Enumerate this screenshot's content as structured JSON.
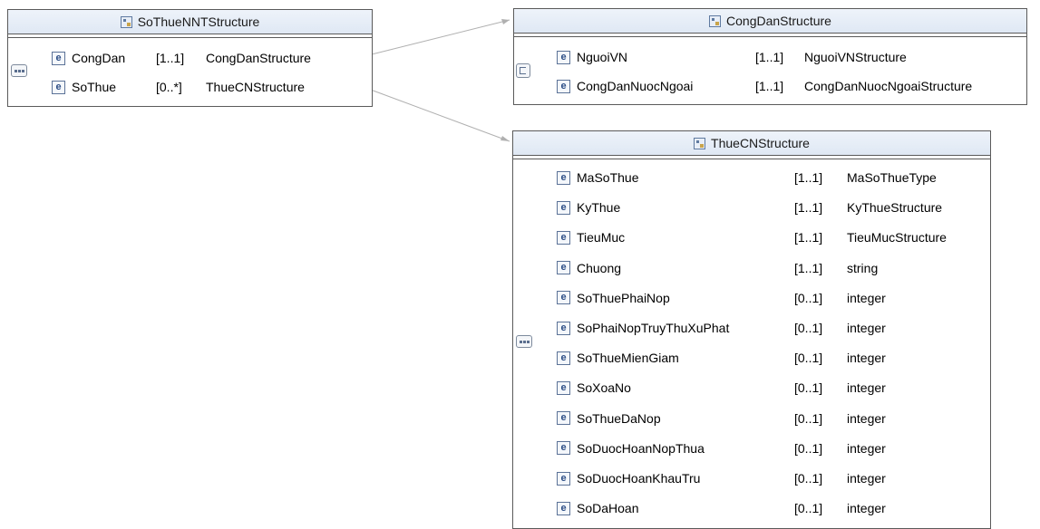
{
  "boxes": {
    "sothue": {
      "title": "SoThueNNTStructure",
      "rows": [
        {
          "name": "CongDan",
          "card": "[1..1]",
          "type": "CongDanStructure"
        },
        {
          "name": "SoThue",
          "card": "[0..*]",
          "type": "ThueCNStructure"
        }
      ]
    },
    "congdan": {
      "title": "CongDanStructure",
      "rows": [
        {
          "name": "NguoiVN",
          "card": "[1..1]",
          "type": "NguoiVNStructure"
        },
        {
          "name": "CongDanNuocNgoai",
          "card": "[1..1]",
          "type": "CongDanNuocNgoaiStructure"
        }
      ]
    },
    "thuecn": {
      "title": "ThueCNStructure",
      "rows": [
        {
          "name": "MaSoThue",
          "card": "[1..1]",
          "type": "MaSoThueType"
        },
        {
          "name": "KyThue",
          "card": "[1..1]",
          "type": "KyThueStructure"
        },
        {
          "name": "TieuMuc",
          "card": "[1..1]",
          "type": "TieuMucStructure"
        },
        {
          "name": "Chuong",
          "card": "[1..1]",
          "type": "string"
        },
        {
          "name": "SoThuePhaiNop",
          "card": "[0..1]",
          "type": "integer"
        },
        {
          "name": "SoPhaiNopTruyThuXuPhat",
          "card": "[0..1]",
          "type": "integer"
        },
        {
          "name": "SoThueMienGiam",
          "card": "[0..1]",
          "type": "integer"
        },
        {
          "name": "SoXoaNo",
          "card": "[0..1]",
          "type": "integer"
        },
        {
          "name": "SoThueDaNop",
          "card": "[0..1]",
          "type": "integer"
        },
        {
          "name": "SoDuocHoanNopThua",
          "card": "[0..1]",
          "type": "integer"
        },
        {
          "name": "SoDuocHoanKhauTru",
          "card": "[0..1]",
          "type": "integer"
        },
        {
          "name": "SoDaHoan",
          "card": "[0..1]",
          "type": "integer"
        }
      ]
    }
  },
  "element_icon_letter": "e",
  "icons": {
    "type": "complex-type-icon",
    "element": "element-icon",
    "sequence": "sequence-compositor-icon",
    "choice": "choice-compositor-icon"
  }
}
